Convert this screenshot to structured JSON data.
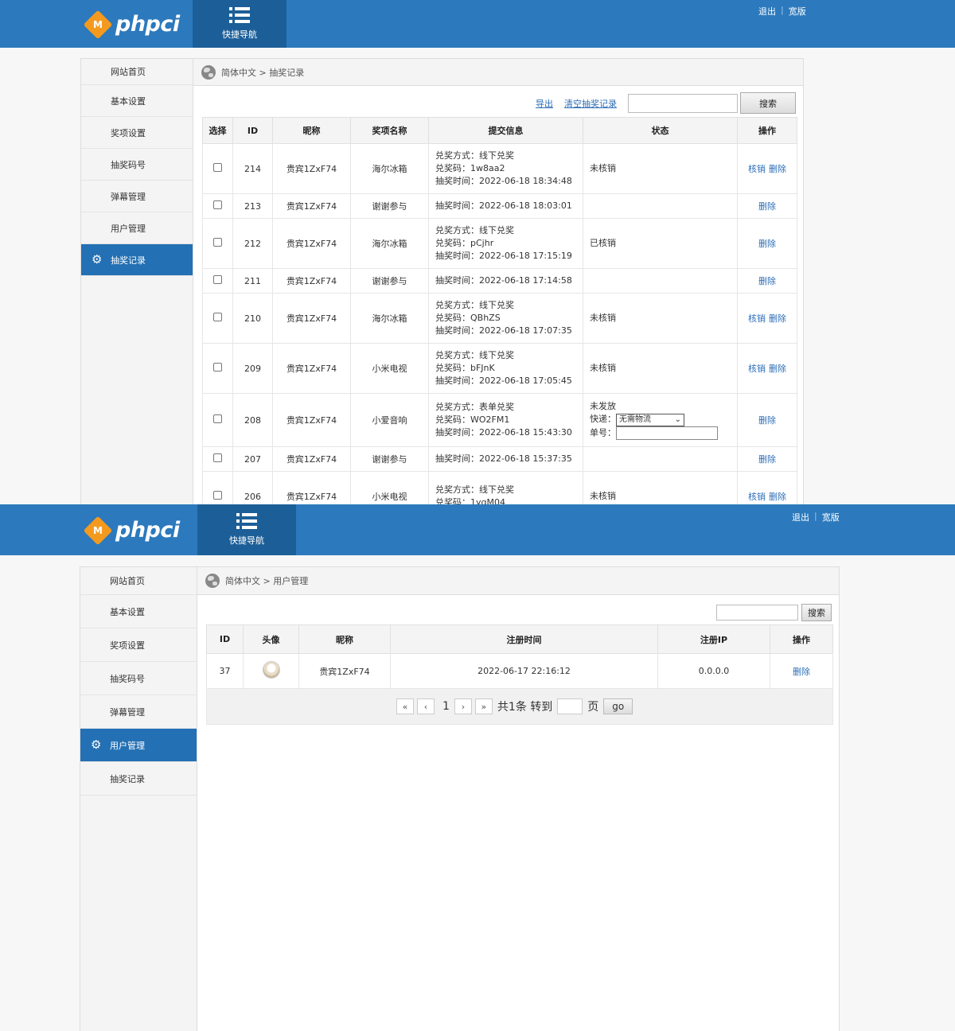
{
  "brand": {
    "logo_letter": "M",
    "logo_text": "phpci",
    "accent": "#2c79bd",
    "dark": "#1c5f98",
    "logo_orange": "#f39a1e"
  },
  "header": {
    "quicknav_label": "快捷导航",
    "logout": "退出",
    "wide": "宽版"
  },
  "sidebar": {
    "items": [
      "网站首页",
      "基本设置",
      "奖项设置",
      "抽奖码号",
      "弹幕管理",
      "用户管理",
      "抽奖记录"
    ]
  },
  "lottery_page": {
    "breadcrumb": "简体中文 > 抽奖记录",
    "export_label": "导出",
    "clear_label": "清空抽奖记录",
    "search_label": "搜索",
    "columns": [
      "选择",
      "ID",
      "昵称",
      "奖项名称",
      "提交信息",
      "状态",
      "操作"
    ],
    "rows": [
      {
        "id": "214",
        "nick": "贵宾1ZxF74",
        "prize": "海尔冰箱",
        "info": [
          "兑奖方式：线下兑奖",
          "兑奖码：1w8aa2",
          "抽奖时间：2022-06-18 18:34:48"
        ],
        "status": "未核销",
        "actions": [
          "核销",
          "删除"
        ]
      },
      {
        "id": "213",
        "nick": "贵宾1ZxF74",
        "prize": "谢谢参与",
        "info": [
          "抽奖时间：2022-06-18 18:03:01"
        ],
        "status": "",
        "actions": [
          "删除"
        ]
      },
      {
        "id": "212",
        "nick": "贵宾1ZxF74",
        "prize": "海尔冰箱",
        "info": [
          "兑奖方式：线下兑奖",
          "兑奖码：pCjhr",
          "抽奖时间：2022-06-18 17:15:19"
        ],
        "status": "已核销",
        "actions": [
          "删除"
        ]
      },
      {
        "id": "211",
        "nick": "贵宾1ZxF74",
        "prize": "谢谢参与",
        "info": [
          "抽奖时间：2022-06-18 17:14:58"
        ],
        "status": "",
        "actions": [
          "删除"
        ]
      },
      {
        "id": "210",
        "nick": "贵宾1ZxF74",
        "prize": "海尔冰箱",
        "info": [
          "兑奖方式：线下兑奖",
          "兑奖码：QBhZS",
          "抽奖时间：2022-06-18 17:07:35"
        ],
        "status": "未核销",
        "actions": [
          "核销",
          "删除"
        ]
      },
      {
        "id": "209",
        "nick": "贵宾1ZxF74",
        "prize": "小米电视",
        "info": [
          "兑奖方式：线下兑奖",
          "兑奖码：bFJnK",
          "抽奖时间：2022-06-18 17:05:45"
        ],
        "status": "未核销",
        "actions": [
          "核销",
          "删除"
        ]
      },
      {
        "id": "208",
        "nick": "贵宾1ZxF74",
        "prize": "小爱音响",
        "info": [
          "兑奖方式：表单兑奖",
          "兑奖码：WO2FM1",
          "抽奖时间：2022-06-18 15:43:30"
        ],
        "status": "未发放",
        "shipping": {
          "courier_label": "快递：",
          "courier_value": "无需物流",
          "tracking_label": "单号："
        },
        "actions": [
          "删除"
        ]
      },
      {
        "id": "207",
        "nick": "贵宾1ZxF74",
        "prize": "谢谢参与",
        "info": [
          "抽奖时间：2022-06-18 15:37:35"
        ],
        "status": "",
        "actions": [
          "删除"
        ]
      },
      {
        "id": "206",
        "nick": "贵宾1ZxF74",
        "prize": "小米电视",
        "info": [
          "兑奖方式：线下兑奖",
          "兑奖码：1ygM04"
        ],
        "status": "未核销",
        "actions": [
          "核销",
          "删除"
        ]
      }
    ]
  },
  "user_page": {
    "breadcrumb": "简体中文 > 用户管理",
    "search_label": "搜索",
    "columns": [
      "ID",
      "头像",
      "昵称",
      "注册时间",
      "注册IP",
      "操作"
    ],
    "rows": [
      {
        "id": "37",
        "nick": "贵宾1ZxF74",
        "reg_time": "2022-06-17 22:16:12",
        "reg_ip": "0.0.0.0",
        "action": "删除"
      }
    ],
    "pager": {
      "first": "«",
      "prev": "‹",
      "page": "1",
      "next": "›",
      "last": "»",
      "total": "共1条 转到",
      "page_unit": "页",
      "go": "go"
    }
  }
}
